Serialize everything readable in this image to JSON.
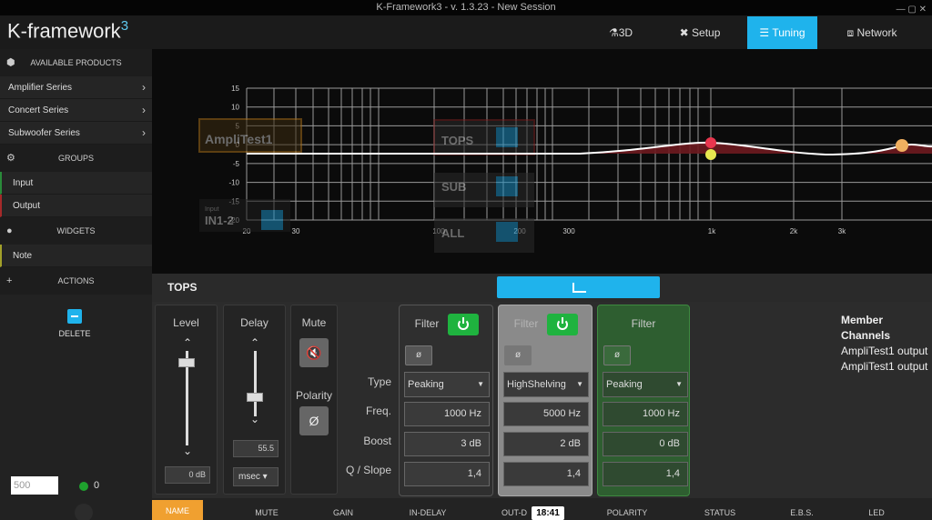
{
  "window": {
    "title": "K-Framework3 - v. 1.3.23 - New Session",
    "controls": "— ▢ ✕"
  },
  "header": {
    "logo_text": "K-framework",
    "logo_super": "3",
    "nav": [
      {
        "icon": "cube-icon",
        "glyph": "⚗",
        "label": "3D"
      },
      {
        "icon": "tools-icon",
        "glyph": "✖",
        "label": "Setup"
      },
      {
        "icon": "sliders-icon",
        "glyph": "☰",
        "label": "Tuning"
      },
      {
        "icon": "network-icon",
        "glyph": "⧈",
        "label": "Network"
      }
    ],
    "active_nav": "Tuning"
  },
  "sidebar": {
    "sections": [
      {
        "title": "AVAILABLE PRODUCTS",
        "glyph": "⬢",
        "items": [
          "Amplifier Series",
          "Concert Series",
          "Subwoofer Series"
        ]
      },
      {
        "title": "GROUPS",
        "glyph": "⚙",
        "items": [
          "Input",
          "Output"
        ]
      },
      {
        "title": "WIDGETS",
        "glyph": "●",
        "items": [
          "Note"
        ]
      },
      {
        "title": "ACTIONS",
        "glyph": "+",
        "items": []
      }
    ],
    "delete_label": "DELETE",
    "number_box": "500",
    "online_count": "0"
  },
  "graph": {
    "y_ticks": [
      "15",
      "10",
      "5",
      "0",
      "-5",
      "-10",
      "-15",
      "-20"
    ],
    "x_ticks": [
      "20",
      "30",
      "100",
      "200",
      "300",
      "1k",
      "2k",
      "3k"
    ],
    "overlays": [
      {
        "label": "AmpliTest1"
      },
      {
        "label": "TOPS"
      },
      {
        "label": "SUB"
      },
      {
        "label": "ALL"
      },
      {
        "label": "IN1-2",
        "sub": "Input"
      }
    ],
    "colors": {
      "grid": "#9a9a9a",
      "curve": "#ffffff",
      "fill": "#6e1a1f",
      "point_red": "#e8364e",
      "point_yellow": "#e8e850",
      "point_orange": "#f0b060"
    }
  },
  "panel": {
    "title": "TOPS",
    "level": {
      "label": "Level",
      "value": "0 dB"
    },
    "delay": {
      "label": "Delay",
      "value": "55.5",
      "unit": "msec"
    },
    "mute": {
      "label": "Mute",
      "polarity_label": "Polarity",
      "polarity_glyph": "Ø"
    },
    "row_labels": {
      "type": "Type",
      "freq": "Freq.",
      "boost": "Boost",
      "q": "Q / Slope"
    },
    "filters": [
      {
        "label": "Filter",
        "phase": "ø",
        "type": "Peaking",
        "freq": "1000 Hz",
        "boost": "3 dB",
        "q": "1,4"
      },
      {
        "label": "Filter",
        "phase": "ø",
        "type": "HighShelving",
        "freq": "5000 Hz",
        "boost": "2 dB",
        "q": "1,4"
      },
      {
        "label": "Filter",
        "phase": "ø",
        "type": "Peaking",
        "freq": "1000 Hz",
        "boost": "0 dB",
        "q": "1,4"
      }
    ],
    "member": {
      "title": "Member Channels",
      "items": [
        "AmpliTest1 output",
        "AmpliTest1 output"
      ]
    }
  },
  "bottom_tabs": [
    "NAME",
    "MUTE",
    "GAIN",
    "IN-DELAY",
    "OUT-D",
    "POLARITY",
    "STATUS",
    "E.B.S.",
    "LED"
  ],
  "clock": "18:41"
}
